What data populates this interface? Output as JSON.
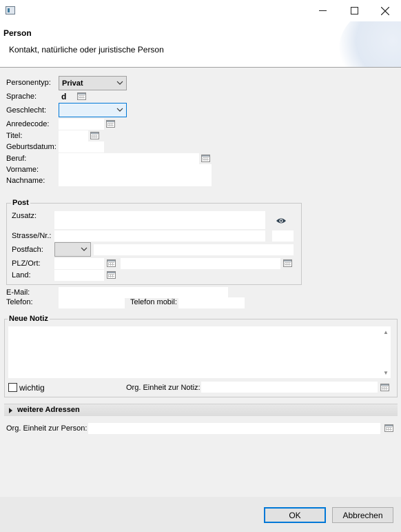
{
  "dialog": {
    "title": "Person",
    "subtitle": "Kontakt, natürliche oder juristische Person"
  },
  "icons": {
    "minimize": "minimize-icon",
    "maximize": "maximize-icon",
    "close": "close-icon",
    "calendar": "calendar-icon",
    "eye": "eye-icon",
    "expand": "triangle-right-icon"
  },
  "person": {
    "typ_label": "Personentyp:",
    "typ_value": "Privat",
    "sprache_label": "Sprache:",
    "sprache_value": "d",
    "geschlecht_label": "Geschlecht:",
    "geschlecht_value": "",
    "anredecode_label": "Anredecode:",
    "titel_label": "Titel:",
    "geburtsdatum_label": "Geburtsdatum:",
    "beruf_label": "Beruf:",
    "vorname_label": "Vorname:",
    "nachname_label": "Nachname:"
  },
  "post": {
    "group_title": "Post",
    "zusatz_label": "Zusatz:",
    "strasse_label": "Strasse/Nr.:",
    "postfach_label": "Postfach:",
    "plz_label": "PLZ/Ort:",
    "land_label": "Land:"
  },
  "contact": {
    "email_label": "E-Mail:",
    "telefon_label": "Telefon:",
    "mobil_label": "Telefon mobil:"
  },
  "notiz": {
    "group_title": "Neue Notiz",
    "wichtig_label": "wichtig",
    "wichtig_checked": false,
    "org_label": "Org. Einheit zur Notiz:"
  },
  "expander": {
    "label": "weitere Adressen"
  },
  "org_person_label": "Org. Einheit zur Person:",
  "buttons": {
    "ok": "OK",
    "cancel": "Abbrechen"
  }
}
